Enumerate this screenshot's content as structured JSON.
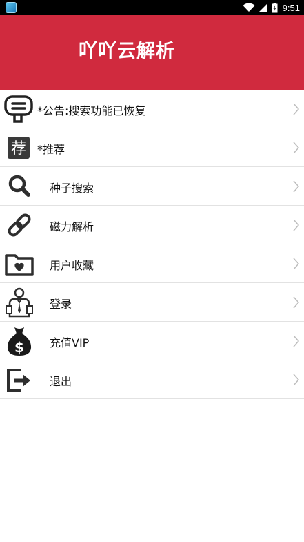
{
  "status_bar": {
    "time": "9:51",
    "app_icon": "app-notification-icon",
    "icons": [
      "wifi-icon",
      "signal-icon",
      "battery-icon"
    ]
  },
  "header": {
    "title": "吖吖云解析",
    "background_color": "#d02a3e"
  },
  "menu": {
    "items": [
      {
        "label": "*公告:搜索功能已恢复",
        "icon": "announcement-icon"
      },
      {
        "label": "*推荐",
        "icon": "recommend-icon"
      },
      {
        "label": "种子搜索",
        "icon": "search-icon"
      },
      {
        "label": "磁力解析",
        "icon": "link-icon"
      },
      {
        "label": "用户收藏",
        "icon": "favorites-folder-icon"
      },
      {
        "label": "登录",
        "icon": "user-login-icon"
      },
      {
        "label": "充值VIP",
        "icon": "money-bag-icon"
      },
      {
        "label": "退出",
        "icon": "exit-icon"
      }
    ]
  }
}
